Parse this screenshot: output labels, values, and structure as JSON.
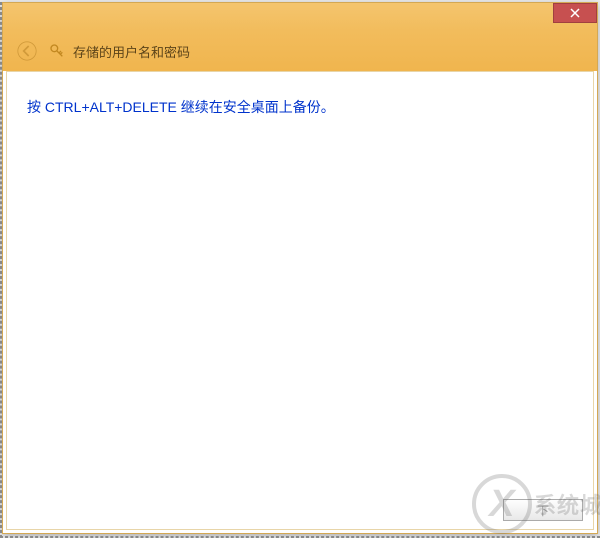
{
  "window": {
    "title": "存储的用户名和密码"
  },
  "content": {
    "message": "按 CTRL+ALT+DELETE 继续在安全桌面上备份。"
  },
  "footer": {
    "next_label": "下"
  },
  "watermark": {
    "text": "系统城"
  }
}
